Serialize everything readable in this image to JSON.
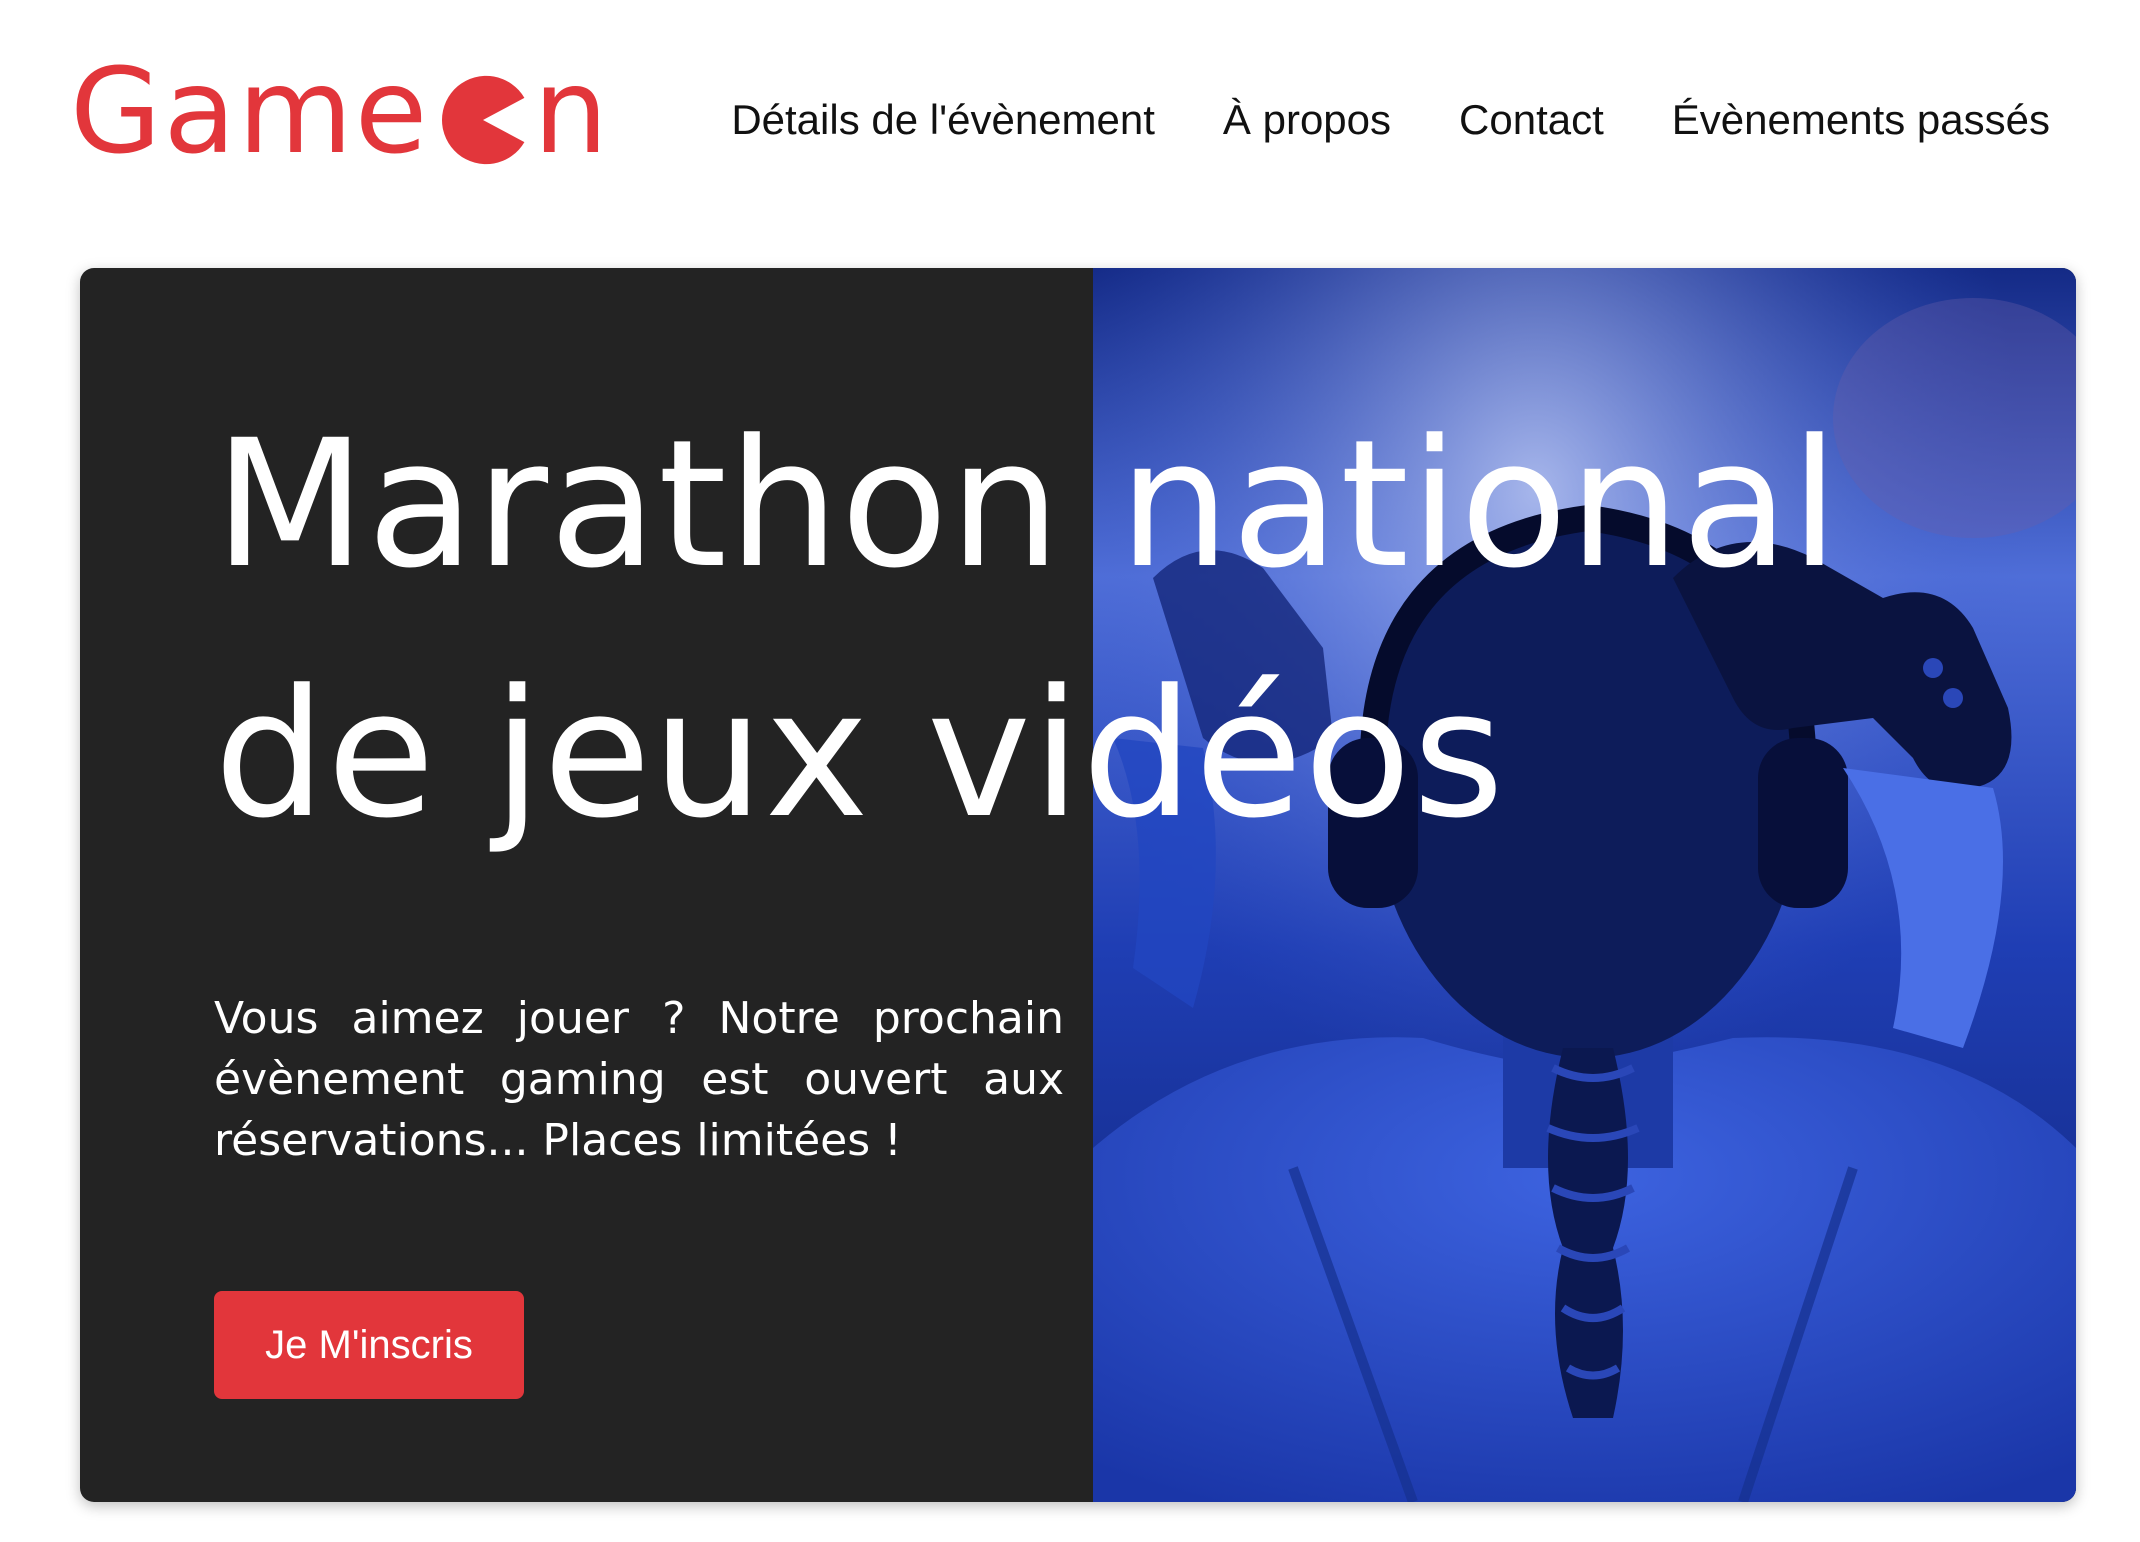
{
  "header": {
    "logo_text_start": "Game",
    "logo_text_end": "n",
    "nav": [
      {
        "label": "Détails de l'évènement"
      },
      {
        "label": "À propos"
      },
      {
        "label": "Contact"
      },
      {
        "label": "Évènements passés"
      }
    ]
  },
  "hero": {
    "title": "Marathon national de jeux vidéos",
    "description": "Vous aimez jouer ? Notre prochain évènement gaming est ouvert aux réservations... Places limitées !",
    "cta_label": "Je M'inscris"
  },
  "colors": {
    "brand_red": "#e2363b",
    "hero_dark": "#232323",
    "photo_blue": "#1a3fb8"
  }
}
